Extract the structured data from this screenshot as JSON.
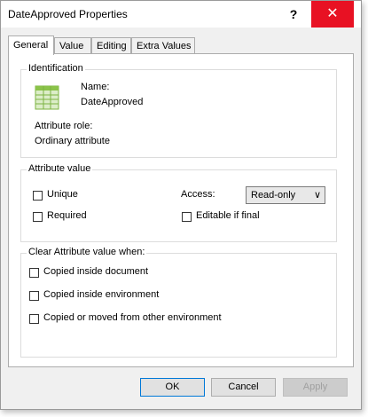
{
  "window": {
    "title": "DateApproved Properties",
    "help_glyph": "?",
    "close_glyph": "✕"
  },
  "tabs": [
    {
      "label": "General",
      "active": true
    },
    {
      "label": "Value",
      "active": false
    },
    {
      "label": "Editing",
      "active": false
    },
    {
      "label": "Extra Values",
      "active": false
    }
  ],
  "identification": {
    "group_title": "Identification",
    "icon": "attribute-grid-icon",
    "name_label": "Name:",
    "name_value": "DateApproved",
    "role_label": "Attribute role:",
    "role_value": "Ordinary attribute"
  },
  "attribute_value": {
    "group_title": "Attribute value",
    "unique_label": "Unique",
    "required_label": "Required",
    "access_label": "Access:",
    "access_selected": "Read-only",
    "editable_label": "Editable if final"
  },
  "clear_when": {
    "group_title": "Clear Attribute value when:",
    "options": [
      "Copied inside document",
      "Copied inside environment",
      "Copied or moved from other environment"
    ]
  },
  "footer": {
    "ok": "OK",
    "cancel": "Cancel",
    "apply": "Apply"
  },
  "colors": {
    "close_red": "#e81123",
    "icon_green": "#8bc34a",
    "default_border": "#0078d7"
  }
}
